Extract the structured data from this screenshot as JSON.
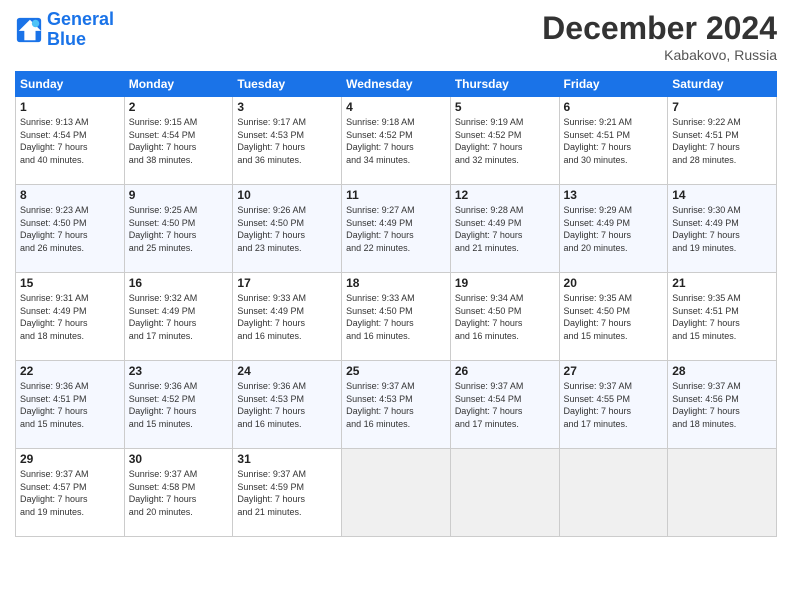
{
  "header": {
    "logo_line1": "General",
    "logo_line2": "Blue",
    "month": "December 2024",
    "location": "Kabakovo, Russia"
  },
  "weekdays": [
    "Sunday",
    "Monday",
    "Tuesday",
    "Wednesday",
    "Thursday",
    "Friday",
    "Saturday"
  ],
  "weeks": [
    [
      {
        "day": "1",
        "info": "Sunrise: 9:13 AM\nSunset: 4:54 PM\nDaylight: 7 hours\nand 40 minutes."
      },
      {
        "day": "2",
        "info": "Sunrise: 9:15 AM\nSunset: 4:54 PM\nDaylight: 7 hours\nand 38 minutes."
      },
      {
        "day": "3",
        "info": "Sunrise: 9:17 AM\nSunset: 4:53 PM\nDaylight: 7 hours\nand 36 minutes."
      },
      {
        "day": "4",
        "info": "Sunrise: 9:18 AM\nSunset: 4:52 PM\nDaylight: 7 hours\nand 34 minutes."
      },
      {
        "day": "5",
        "info": "Sunrise: 9:19 AM\nSunset: 4:52 PM\nDaylight: 7 hours\nand 32 minutes."
      },
      {
        "day": "6",
        "info": "Sunrise: 9:21 AM\nSunset: 4:51 PM\nDaylight: 7 hours\nand 30 minutes."
      },
      {
        "day": "7",
        "info": "Sunrise: 9:22 AM\nSunset: 4:51 PM\nDaylight: 7 hours\nand 28 minutes."
      }
    ],
    [
      {
        "day": "8",
        "info": "Sunrise: 9:23 AM\nSunset: 4:50 PM\nDaylight: 7 hours\nand 26 minutes."
      },
      {
        "day": "9",
        "info": "Sunrise: 9:25 AM\nSunset: 4:50 PM\nDaylight: 7 hours\nand 25 minutes."
      },
      {
        "day": "10",
        "info": "Sunrise: 9:26 AM\nSunset: 4:50 PM\nDaylight: 7 hours\nand 23 minutes."
      },
      {
        "day": "11",
        "info": "Sunrise: 9:27 AM\nSunset: 4:49 PM\nDaylight: 7 hours\nand 22 minutes."
      },
      {
        "day": "12",
        "info": "Sunrise: 9:28 AM\nSunset: 4:49 PM\nDaylight: 7 hours\nand 21 minutes."
      },
      {
        "day": "13",
        "info": "Sunrise: 9:29 AM\nSunset: 4:49 PM\nDaylight: 7 hours\nand 20 minutes."
      },
      {
        "day": "14",
        "info": "Sunrise: 9:30 AM\nSunset: 4:49 PM\nDaylight: 7 hours\nand 19 minutes."
      }
    ],
    [
      {
        "day": "15",
        "info": "Sunrise: 9:31 AM\nSunset: 4:49 PM\nDaylight: 7 hours\nand 18 minutes."
      },
      {
        "day": "16",
        "info": "Sunrise: 9:32 AM\nSunset: 4:49 PM\nDaylight: 7 hours\nand 17 minutes."
      },
      {
        "day": "17",
        "info": "Sunrise: 9:33 AM\nSunset: 4:49 PM\nDaylight: 7 hours\nand 16 minutes."
      },
      {
        "day": "18",
        "info": "Sunrise: 9:33 AM\nSunset: 4:50 PM\nDaylight: 7 hours\nand 16 minutes."
      },
      {
        "day": "19",
        "info": "Sunrise: 9:34 AM\nSunset: 4:50 PM\nDaylight: 7 hours\nand 16 minutes."
      },
      {
        "day": "20",
        "info": "Sunrise: 9:35 AM\nSunset: 4:50 PM\nDaylight: 7 hours\nand 15 minutes."
      },
      {
        "day": "21",
        "info": "Sunrise: 9:35 AM\nSunset: 4:51 PM\nDaylight: 7 hours\nand 15 minutes."
      }
    ],
    [
      {
        "day": "22",
        "info": "Sunrise: 9:36 AM\nSunset: 4:51 PM\nDaylight: 7 hours\nand 15 minutes."
      },
      {
        "day": "23",
        "info": "Sunrise: 9:36 AM\nSunset: 4:52 PM\nDaylight: 7 hours\nand 15 minutes."
      },
      {
        "day": "24",
        "info": "Sunrise: 9:36 AM\nSunset: 4:53 PM\nDaylight: 7 hours\nand 16 minutes."
      },
      {
        "day": "25",
        "info": "Sunrise: 9:37 AM\nSunset: 4:53 PM\nDaylight: 7 hours\nand 16 minutes."
      },
      {
        "day": "26",
        "info": "Sunrise: 9:37 AM\nSunset: 4:54 PM\nDaylight: 7 hours\nand 17 minutes."
      },
      {
        "day": "27",
        "info": "Sunrise: 9:37 AM\nSunset: 4:55 PM\nDaylight: 7 hours\nand 17 minutes."
      },
      {
        "day": "28",
        "info": "Sunrise: 9:37 AM\nSunset: 4:56 PM\nDaylight: 7 hours\nand 18 minutes."
      }
    ],
    [
      {
        "day": "29",
        "info": "Sunrise: 9:37 AM\nSunset: 4:57 PM\nDaylight: 7 hours\nand 19 minutes."
      },
      {
        "day": "30",
        "info": "Sunrise: 9:37 AM\nSunset: 4:58 PM\nDaylight: 7 hours\nand 20 minutes."
      },
      {
        "day": "31",
        "info": "Sunrise: 9:37 AM\nSunset: 4:59 PM\nDaylight: 7 hours\nand 21 minutes."
      },
      {
        "day": "",
        "info": ""
      },
      {
        "day": "",
        "info": ""
      },
      {
        "day": "",
        "info": ""
      },
      {
        "day": "",
        "info": ""
      }
    ]
  ]
}
